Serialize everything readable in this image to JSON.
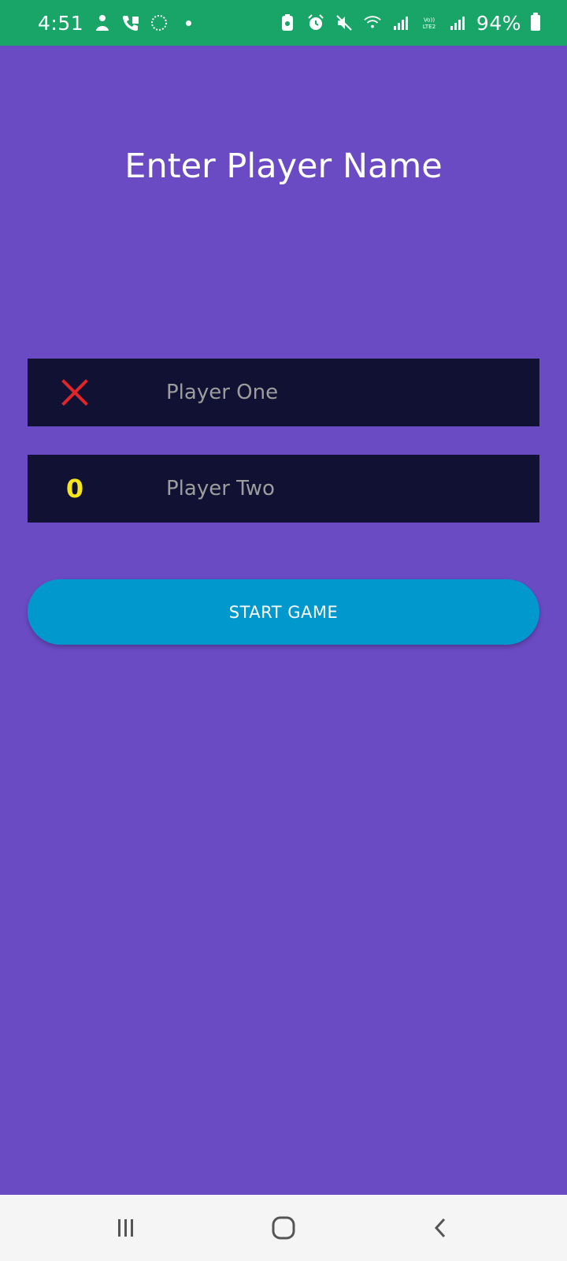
{
  "status_bar": {
    "time": "4:51",
    "battery": "94%",
    "background_color": "#18a567",
    "left_icons": [
      "person-icon",
      "phone-call-icon",
      "sync-icon"
    ],
    "right_icons": [
      "battery-saver-icon",
      "alarm-icon",
      "mute-icon",
      "wifi-icon",
      "signal-icon",
      "volte-lte2-icon",
      "signal-icon",
      "charging-battery-icon"
    ]
  },
  "screen": {
    "title": "Enter Player Name",
    "background_color": "#6a4bc4"
  },
  "players": [
    {
      "mark_icon": "x-mark-icon",
      "mark_color": "#e0262a",
      "placeholder": "Player One",
      "value": ""
    },
    {
      "mark_label": "0",
      "mark_color": "#f5e51b",
      "placeholder": "Player Two",
      "value": ""
    }
  ],
  "start_button": {
    "label": "START GAME",
    "color": "#0198cd"
  },
  "nav_bar": {
    "icons": [
      "recent-apps-icon",
      "home-icon",
      "back-icon"
    ]
  }
}
